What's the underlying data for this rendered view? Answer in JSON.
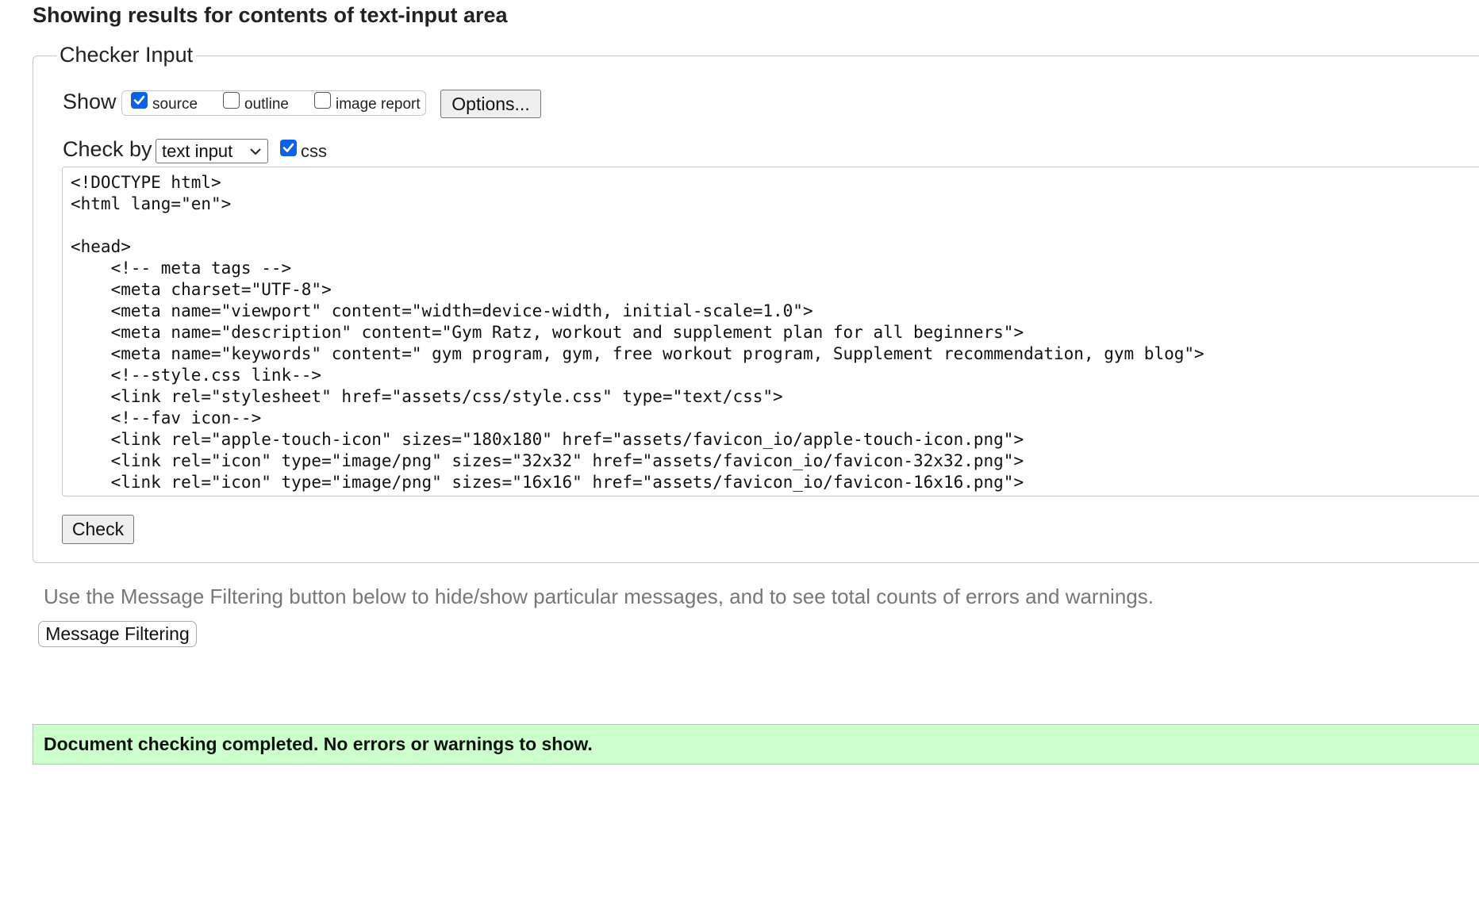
{
  "page_title": "Showing results for contents of text-input area",
  "checker": {
    "legend": "Checker Input",
    "show_label": "Show",
    "show_options": [
      {
        "label": "source",
        "checked": true
      },
      {
        "label": "outline",
        "checked": false
      },
      {
        "label": "image report",
        "checked": false
      }
    ],
    "options_button": "Options...",
    "check_by_label": "Check by",
    "check_by_value": "text input",
    "css_option": {
      "label": "css",
      "checked": true
    },
    "source_lines": [
      "<!DOCTYPE html>",
      "<html lang=\"en\">",
      "",
      "<head>",
      "    <!-- meta tags -->",
      "    <meta charset=\"UTF-8\">",
      "    <meta name=\"viewport\" content=\"width=device-width, initial-scale=1.0\">",
      "    <meta name=\"description\" content=\"Gym Ratz, workout and supplement plan for all beginners\">",
      "    <meta name=\"keywords\" content=\" gym program, gym, free workout program, Supplement recommendation, gym blog\">",
      "    <!--style.css link-->",
      "    <link rel=\"stylesheet\" href=\"assets/css/style.css\" type=\"text/css\">",
      "    <!--fav icon-->",
      "    <link rel=\"apple-touch-icon\" sizes=\"180x180\" href=\"assets/favicon_io/apple-touch-icon.png\">",
      "    <link rel=\"icon\" type=\"image/png\" sizes=\"32x32\" href=\"assets/favicon_io/favicon-32x32.png\">",
      "    <link rel=\"icon\" type=\"image/png\" sizes=\"16x16\" href=\"assets/favicon_io/favicon-16x16.png\">"
    ],
    "check_button": "Check"
  },
  "filter_note": "Use the Message Filtering button below to hide/show particular messages, and to see total counts of errors and warnings.",
  "message_filtering_button": "Message Filtering",
  "result_message": "Document checking completed. No errors or warnings to show.",
  "colors": {
    "checkbox_checked": "#0b62e8",
    "success_bg": "#ccffcc"
  }
}
